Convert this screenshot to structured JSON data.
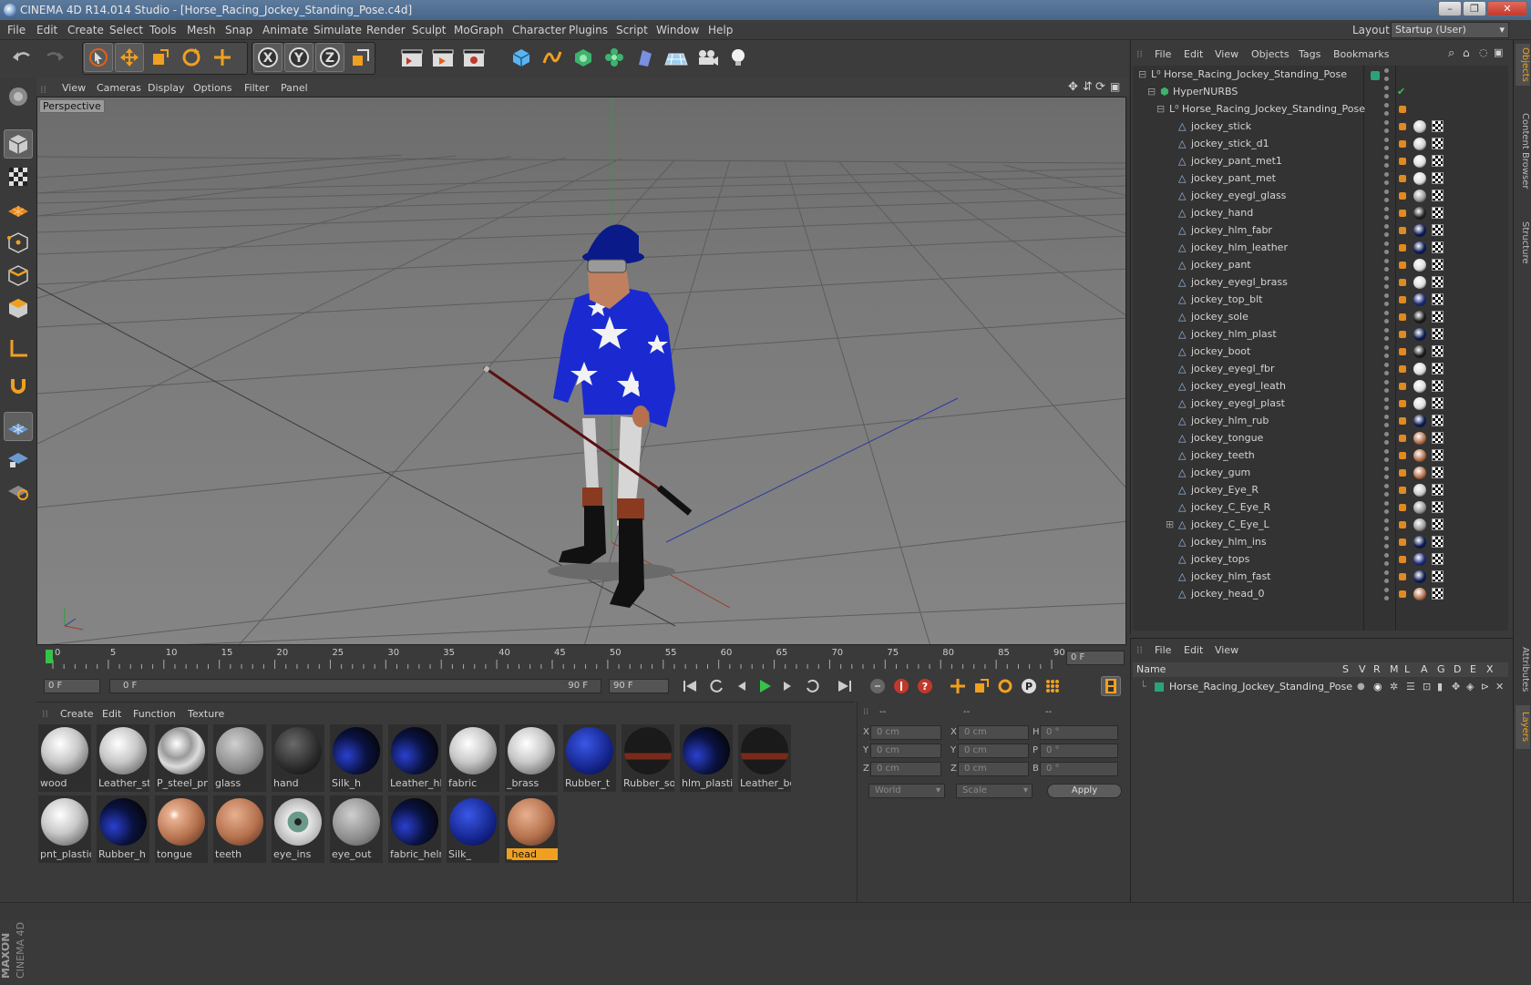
{
  "window": {
    "title": "CINEMA 4D R14.014 Studio - [Horse_Racing_Jockey_Standing_Pose.c4d]"
  },
  "menu": [
    "File",
    "Edit",
    "Create",
    "Select",
    "Tools",
    "Mesh",
    "Snap",
    "Animate",
    "Simulate",
    "Render",
    "Sculpt",
    "MoGraph",
    "Character",
    "Plugins",
    "Script",
    "Window",
    "Help"
  ],
  "layout": {
    "label": "Layout:",
    "value": "Startup (User)"
  },
  "viewport": {
    "menu": [
      "View",
      "Cameras",
      "Display",
      "Options",
      "Filter",
      "Panel"
    ],
    "label": "Perspective"
  },
  "timeline": {
    "ticks": [
      "0",
      "5",
      "10",
      "15",
      "20",
      "25",
      "30",
      "35",
      "40",
      "45",
      "50",
      "55",
      "60",
      "65",
      "70",
      "75",
      "80",
      "85",
      "90"
    ],
    "current_frame": "0 F"
  },
  "transport": {
    "start": "0 F",
    "range_start": "0 F",
    "range_end": "90 F",
    "end": "90 F"
  },
  "materials": {
    "menu": [
      "Create",
      "Edit",
      "Function",
      "Texture"
    ],
    "items": [
      {
        "name": "wood",
        "style": "white"
      },
      {
        "name": "Leather_st",
        "style": "white"
      },
      {
        "name": "P_steel_pnt",
        "style": "chrome"
      },
      {
        "name": "glass",
        "style": "glass"
      },
      {
        "name": "hand",
        "style": "dark"
      },
      {
        "name": "Silk_h",
        "style": "blue-dark"
      },
      {
        "name": "Leather_hlm",
        "style": "blue-dark"
      },
      {
        "name": "fabric",
        "style": "white"
      },
      {
        "name": "_brass",
        "style": "white"
      },
      {
        "name": "Rubber_t",
        "style": "stars"
      },
      {
        "name": "Rubber_so",
        "style": "dark-red"
      },
      {
        "name": "hlm_plastic",
        "style": "blue-dark"
      },
      {
        "name": "Leather_bo",
        "style": "dark-red"
      },
      {
        "name": "pnt_plastic",
        "style": "white"
      },
      {
        "name": "Rubber_h",
        "style": "blue-dark"
      },
      {
        "name": "tongue",
        "style": "skin-shiny"
      },
      {
        "name": "teeth",
        "style": "skin"
      },
      {
        "name": "eye_ins",
        "style": "eye"
      },
      {
        "name": "eye_out",
        "style": "glass"
      },
      {
        "name": "fabric_helm",
        "style": "blue-dark"
      },
      {
        "name": "Silk_",
        "style": "stars"
      },
      {
        "name": "_head",
        "style": "skin"
      }
    ],
    "active": "_head"
  },
  "attributes": {
    "header": [
      "--",
      "--",
      "--"
    ],
    "rows": [
      {
        "a": "X",
        "av": "0 cm",
        "b": "X",
        "bv": "0 cm",
        "c": "H",
        "cv": "0 °"
      },
      {
        "a": "Y",
        "av": "0 cm",
        "b": "Y",
        "bv": "0 cm",
        "c": "P",
        "cv": "0 °"
      },
      {
        "a": "Z",
        "av": "0 cm",
        "b": "Z",
        "bv": "0 cm",
        "c": "B",
        "cv": "0 °"
      }
    ],
    "coord_mode": "World",
    "size_mode": "Scale",
    "apply": "Apply"
  },
  "objects": {
    "menu": [
      "File",
      "Edit",
      "View",
      "Objects",
      "Tags",
      "Bookmarks"
    ],
    "root": "Horse_Racing_Jockey_Standing_Pose",
    "hypernurbs": "HyperNURBS",
    "group": "Horse_Racing_Jockey_Standing_Pose",
    "items": [
      {
        "name": "jockey_stick",
        "tag": "#cfcfcf"
      },
      {
        "name": "jockey_stick_d1",
        "tag": "#cfcfcf"
      },
      {
        "name": "jockey_pant_met1",
        "tag": "#dcdcdc"
      },
      {
        "name": "jockey_pant_met",
        "tag": "#dcdcdc"
      },
      {
        "name": "jockey_eyegl_glass",
        "tag": "#9a9a9a"
      },
      {
        "name": "jockey_hand",
        "tag": "#222222"
      },
      {
        "name": "jockey_hlm_fabr",
        "tag": "#0a1a55"
      },
      {
        "name": "jockey_hlm_leather",
        "tag": "#0a1a55"
      },
      {
        "name": "jockey_pant",
        "tag": "#dcdcdc"
      },
      {
        "name": "jockey_eyegl_brass",
        "tag": "#dcdcdc"
      },
      {
        "name": "jockey_top_blt",
        "tag": "#1a2a7a"
      },
      {
        "name": "jockey_sole",
        "tag": "#1a1a1a"
      },
      {
        "name": "jockey_hlm_plast",
        "tag": "#0a1a55"
      },
      {
        "name": "jockey_boot",
        "tag": "#1a1a1a"
      },
      {
        "name": "jockey_eyegl_fbr",
        "tag": "#dcdcdc"
      },
      {
        "name": "jockey_eyegl_leath",
        "tag": "#dcdcdc"
      },
      {
        "name": "jockey_eyegl_plast",
        "tag": "#dcdcdc"
      },
      {
        "name": "jockey_hlm_rub",
        "tag": "#0a1a55"
      },
      {
        "name": "jockey_tongue",
        "tag": "#b5714d"
      },
      {
        "name": "jockey_teeth",
        "tag": "#b5714d"
      },
      {
        "name": "jockey_gum",
        "tag": "#b5714d"
      },
      {
        "name": "jockey_Eye_R",
        "tag": "#c8c8c8"
      },
      {
        "name": "jockey_C_Eye_R",
        "tag": "#9a9a9a"
      },
      {
        "name": "jockey_C_Eye_L",
        "tag": "#9a9a9a"
      },
      {
        "name": "jockey_hlm_ins",
        "tag": "#0a1a55"
      },
      {
        "name": "jockey_tops",
        "tag": "#1a2a7a"
      },
      {
        "name": "jockey_hlm_fast",
        "tag": "#0a1a55"
      },
      {
        "name": "jockey_head_0",
        "tag": "#b5714d"
      }
    ]
  },
  "layers": {
    "menu": [
      "File",
      "Edit",
      "View"
    ],
    "columns": [
      "Name",
      "S",
      "V",
      "R",
      "M",
      "L",
      "A",
      "G",
      "D",
      "E",
      "X"
    ],
    "rows": [
      "Horse_Racing_Jockey_Standing_Pose"
    ]
  },
  "right_tabs": [
    "Objects",
    "Content Browser",
    "Structure",
    "Attributes",
    "Layers"
  ]
}
